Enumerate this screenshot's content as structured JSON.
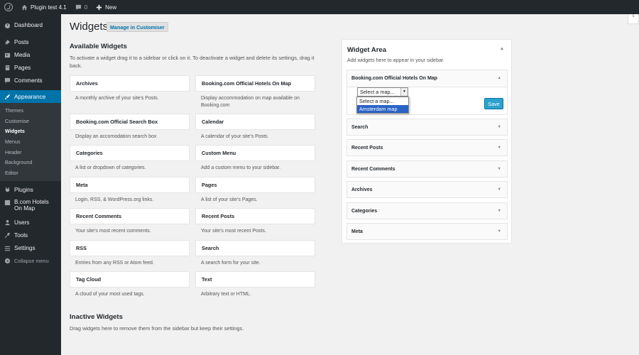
{
  "adminbar": {
    "site_name": "Plugin test 4.1",
    "comments_count": "0",
    "new_label": "New"
  },
  "sidebar": {
    "items": [
      {
        "label": "Dashboard",
        "icon": "dashboard-icon"
      },
      {
        "label": "Posts",
        "icon": "pin-icon"
      },
      {
        "label": "Media",
        "icon": "media-icon"
      },
      {
        "label": "Pages",
        "icon": "pages-icon"
      },
      {
        "label": "Comments",
        "icon": "comment-icon"
      },
      {
        "label": "Appearance",
        "icon": "paintbrush-icon"
      },
      {
        "label": "Plugins",
        "icon": "plugin-icon"
      },
      {
        "label": "B.com Hotels On Map",
        "icon": "map-icon"
      },
      {
        "label": "Users",
        "icon": "users-icon"
      },
      {
        "label": "Tools",
        "icon": "wrench-icon"
      },
      {
        "label": "Settings",
        "icon": "settings-icon"
      }
    ],
    "submenu": [
      "Themes",
      "Customise",
      "Widgets",
      "Menus",
      "Header",
      "Background",
      "Editor"
    ],
    "collapse_label": "Collapse menu"
  },
  "page": {
    "title": "Widgets",
    "manage_label": "Manage in Customiser"
  },
  "available": {
    "title": "Available Widgets",
    "description": "To activate a widget drag it to a sidebar or click on it. To deactivate a widget and delete its settings, drag it back.",
    "widgets": [
      {
        "name": "Archives",
        "desc": "A monthly archive of your site’s Posts."
      },
      {
        "name": "Booking.com Official Hotels On Map",
        "desc": "Display accommodation on map available on Booking.com"
      },
      {
        "name": "Booking.com Official Search Box",
        "desc": "Display an accomodation search box"
      },
      {
        "name": "Calendar",
        "desc": "A calendar of your site’s Posts."
      },
      {
        "name": "Categories",
        "desc": "A list or dropdown of categories."
      },
      {
        "name": "Custom Menu",
        "desc": "Add a custom menu to your sidebar."
      },
      {
        "name": "Meta",
        "desc": "Login, RSS, & WordPress.org links."
      },
      {
        "name": "Pages",
        "desc": "A list of your site’s Pages."
      },
      {
        "name": "Recent Comments",
        "desc": "Your site’s most recent comments."
      },
      {
        "name": "Recent Posts",
        "desc": "Your site’s most recent Posts."
      },
      {
        "name": "RSS",
        "desc": "Entries from any RSS or Atom feed."
      },
      {
        "name": "Search",
        "desc": "A search form for your site."
      },
      {
        "name": "Tag Cloud",
        "desc": "A cloud of your most used tags."
      },
      {
        "name": "Text",
        "desc": "Arbitrary text or HTML."
      }
    ]
  },
  "inactive": {
    "title": "Inactive Widgets",
    "description": "Drag widgets here to remove them from the sidebar but keep their settings."
  },
  "widget_area": {
    "title": "Widget Area",
    "description": "Add widgets here to appear in your sidebar.",
    "open_widget": {
      "title": "Booking.com Official Hotels On Map",
      "select_value": "Select a map...",
      "options": [
        "Select a map...",
        "Amsterdam map"
      ],
      "highlighted_option": "Amsterdam map",
      "save_label": "Save"
    },
    "widgets": [
      "Search",
      "Recent Posts",
      "Recent Comments",
      "Archives",
      "Categories",
      "Meta"
    ]
  },
  "colors": {
    "adminbar_bg": "#23282d",
    "accent": "#0073aa",
    "save_button": "#2ea2cc",
    "dropdown_highlight": "#2a63c6"
  }
}
